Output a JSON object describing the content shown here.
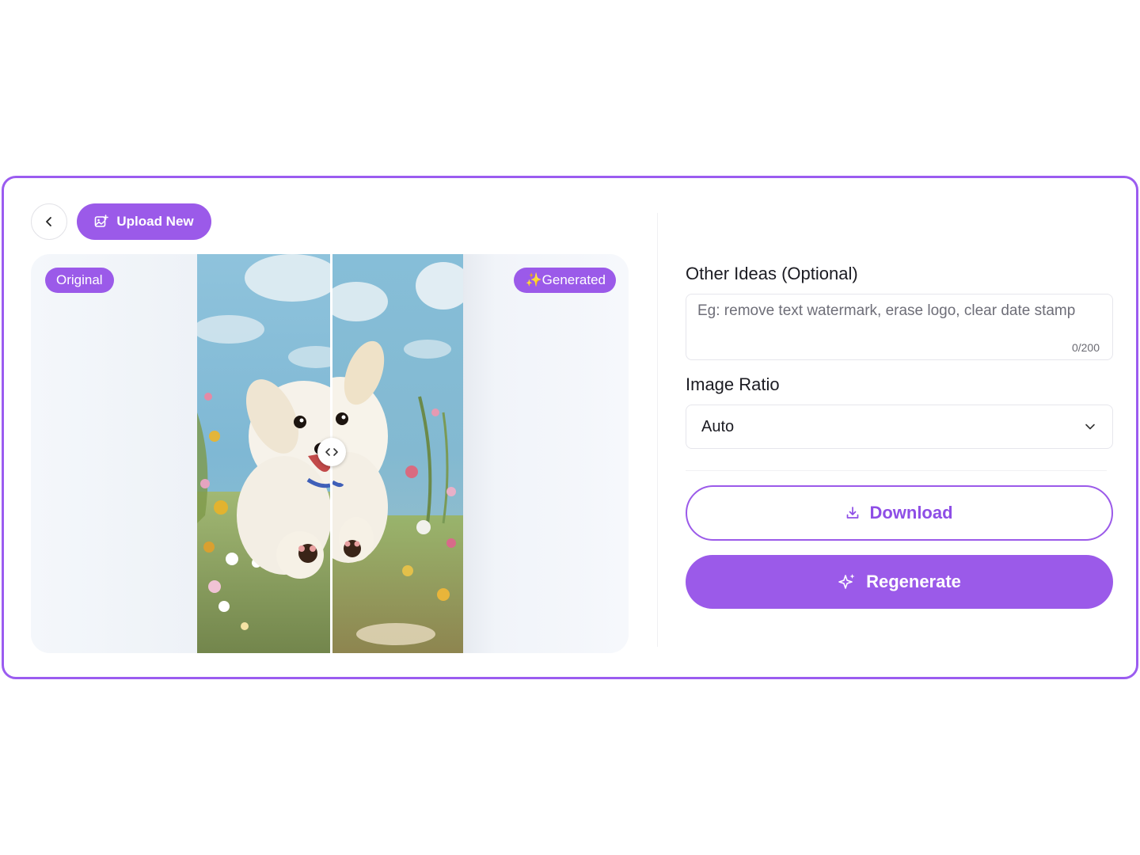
{
  "toolbar": {
    "back_icon": "chevron-left-icon",
    "upload_label": "Upload New",
    "upload_icon": "image-plus-icon"
  },
  "compare": {
    "original_label": "Original",
    "generated_label": "✨Generated",
    "handle_icon": "code-arrows-icon",
    "divider_position": 0.5
  },
  "form": {
    "ideas_label": "Other Ideas (Optional)",
    "ideas_placeholder": "Eg: remove text watermark, erase logo, clear date stamp",
    "ideas_value": "",
    "ideas_counter": "0/200",
    "ratio_label": "Image Ratio",
    "ratio_value": "Auto",
    "ratio_icon": "chevron-down-icon"
  },
  "actions": {
    "download_label": "Download",
    "download_icon": "download-icon",
    "regenerate_label": "Regenerate",
    "regenerate_icon": "sparkles-icon"
  },
  "colors": {
    "accent": "#9b5ae9",
    "border": "#9b5cf0"
  }
}
